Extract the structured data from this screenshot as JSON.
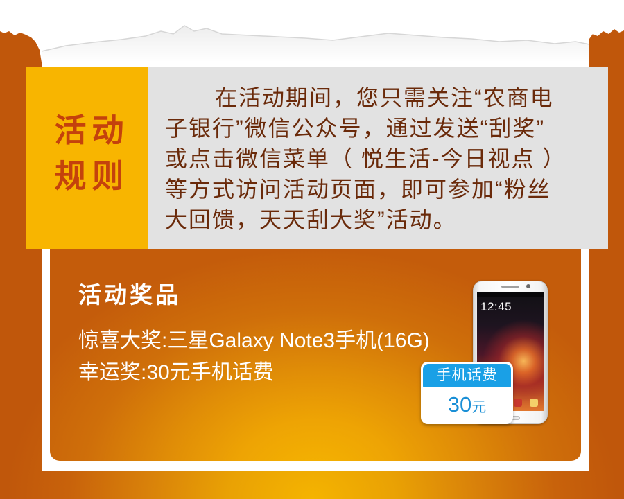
{
  "rules": {
    "title_lines": [
      "活动",
      "规则"
    ],
    "lines": [
      "在活动期间，您只需关注“农商电",
      "子银行”微信公众号，通过发送“刮奖”",
      "或点击微信菜单（ 悦生活-今日视点 ）",
      "等方式访问活动页面，即可参加“粉丝",
      "大回馈，天天刮大奖”活动。"
    ]
  },
  "prizes": {
    "title": "活动奖品",
    "grand_prize": "惊喜大奖:三星Galaxy Note3手机(16G)",
    "lucky_prize": "幸运奖:30元手机话费"
  },
  "phone_image": {
    "screen_time": "12:45"
  },
  "phone_credit_badge": {
    "label": "手机话费",
    "amount": "30",
    "unit": "元"
  },
  "colors": {
    "page-bg": "#c0570b",
    "glow": "#f5b400",
    "rules-title-bg": "#f8b500",
    "rules-title-text": "#c4420c",
    "rules-text-bg": "#e2e2e2",
    "rules-text": "#6a2a0a",
    "badge-blue": "#1aa0e6",
    "badge-amount": "#1a8fd6"
  }
}
